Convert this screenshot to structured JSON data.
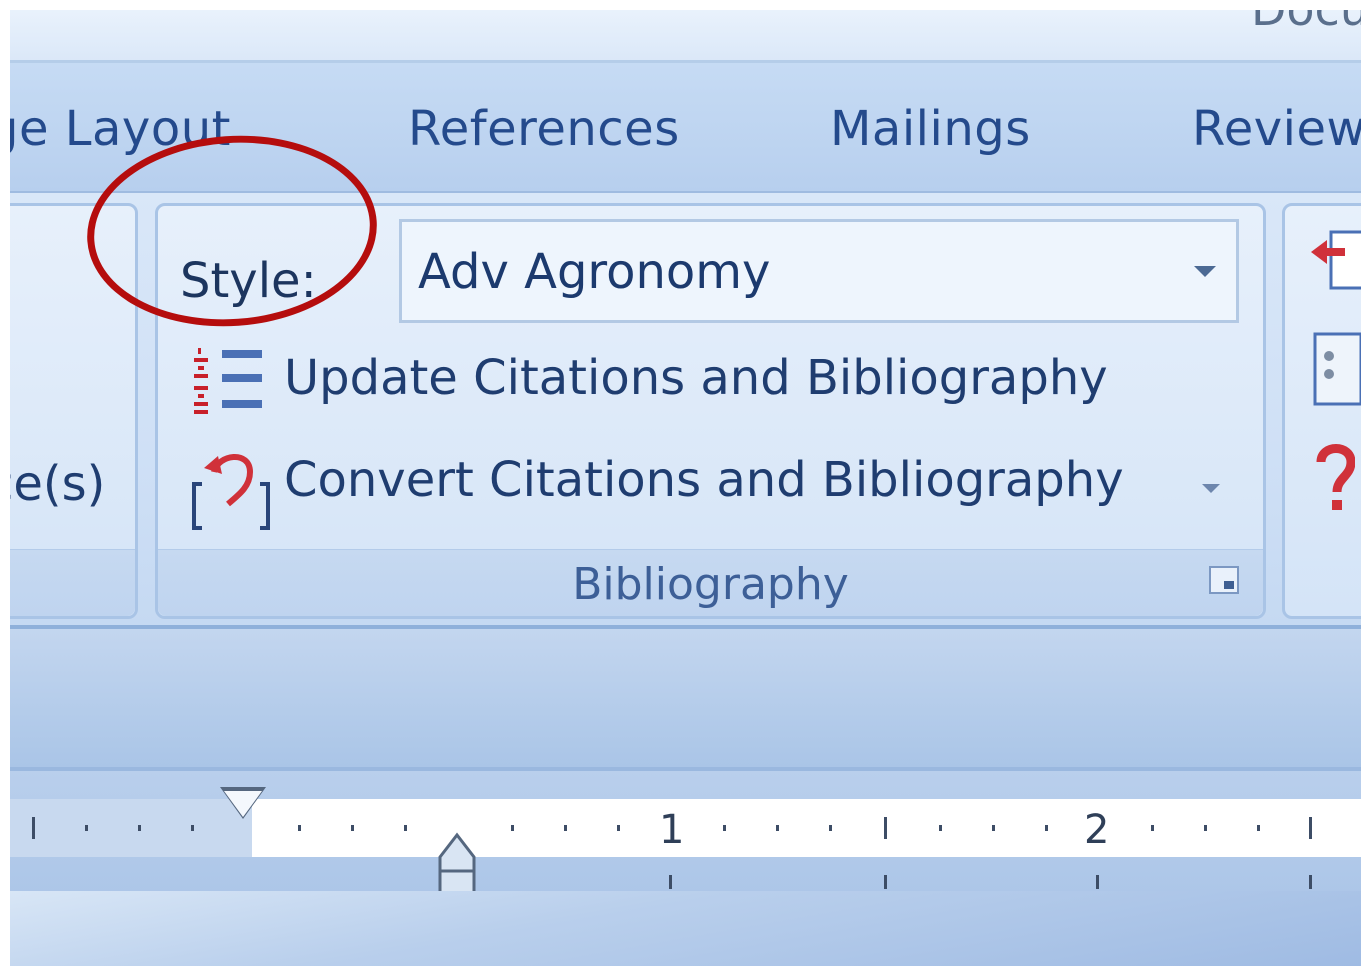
{
  "window": {
    "title_fragment": "Docu"
  },
  "tabs": [
    {
      "label": "ge Layout"
    },
    {
      "label": "References"
    },
    {
      "label": "Mailings"
    },
    {
      "label": "Review"
    }
  ],
  "left_group": {
    "partial_label": "ce(s)"
  },
  "bibliography_group": {
    "title": "Bibliography",
    "style_label": "Style:",
    "style_value": "Adv Agronomy",
    "update_label": "Update Citations and Bibliography",
    "convert_label": "Convert Citations and Bibliography"
  },
  "ruler": {
    "numbers": [
      "1",
      "2"
    ]
  },
  "colors": {
    "ribbon_text": "#1f3d70",
    "highlight": "#b50d0d",
    "ribbon_bg": "#d9e7f8"
  },
  "icons": [
    "update-citations-icon",
    "convert-citations-icon",
    "dialog-launcher-icon",
    "dropdown-arrow-icon",
    "first-line-indent-icon",
    "hanging-indent-icon"
  ]
}
